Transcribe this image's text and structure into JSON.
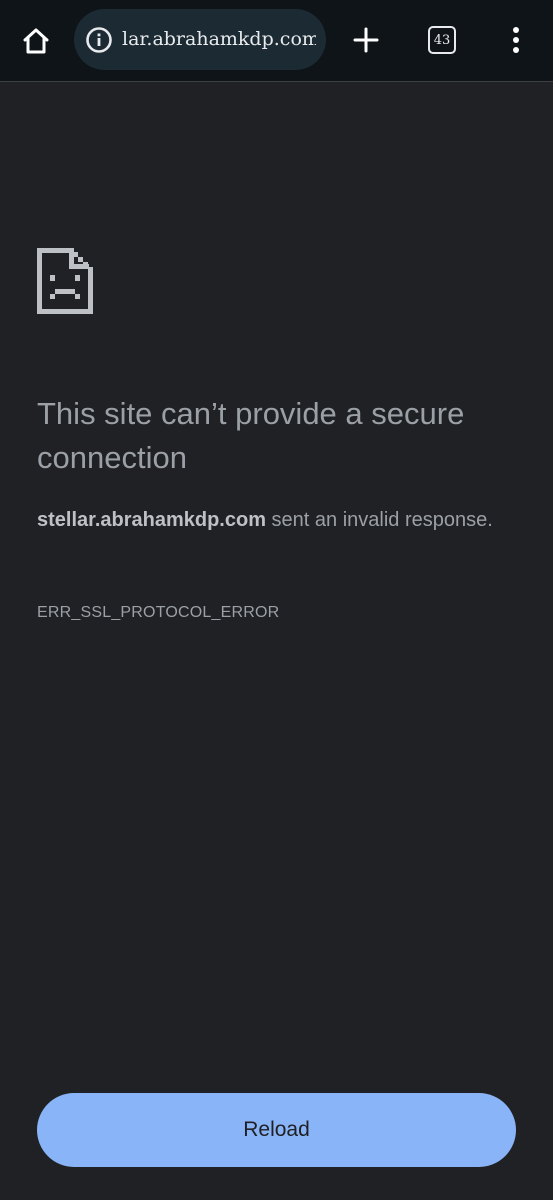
{
  "toolbar": {
    "url_text": "lar.abrahamkdp.com",
    "tab_count": "43",
    "icons": {
      "home": "home-icon",
      "site_info": "info-icon",
      "new_tab": "plus-icon",
      "tab_switcher": "tab-switcher-icon",
      "menu": "more-vert-icon"
    }
  },
  "error_page": {
    "icon": "sad-page-icon",
    "title": "This site can’t provide a secure connection",
    "host": "stellar.abrahamkdp.com",
    "message_suffix": " sent an invalid response.",
    "error_code": "ERR_SSL_PROTOCOL_ERROR",
    "reload_label": "Reload"
  },
  "colors": {
    "background": "#202124",
    "toolbar": "#0f1419",
    "omnibox": "#1c2b33",
    "text_secondary": "#9aa0a6",
    "accent_button": "#8ab4f8"
  }
}
